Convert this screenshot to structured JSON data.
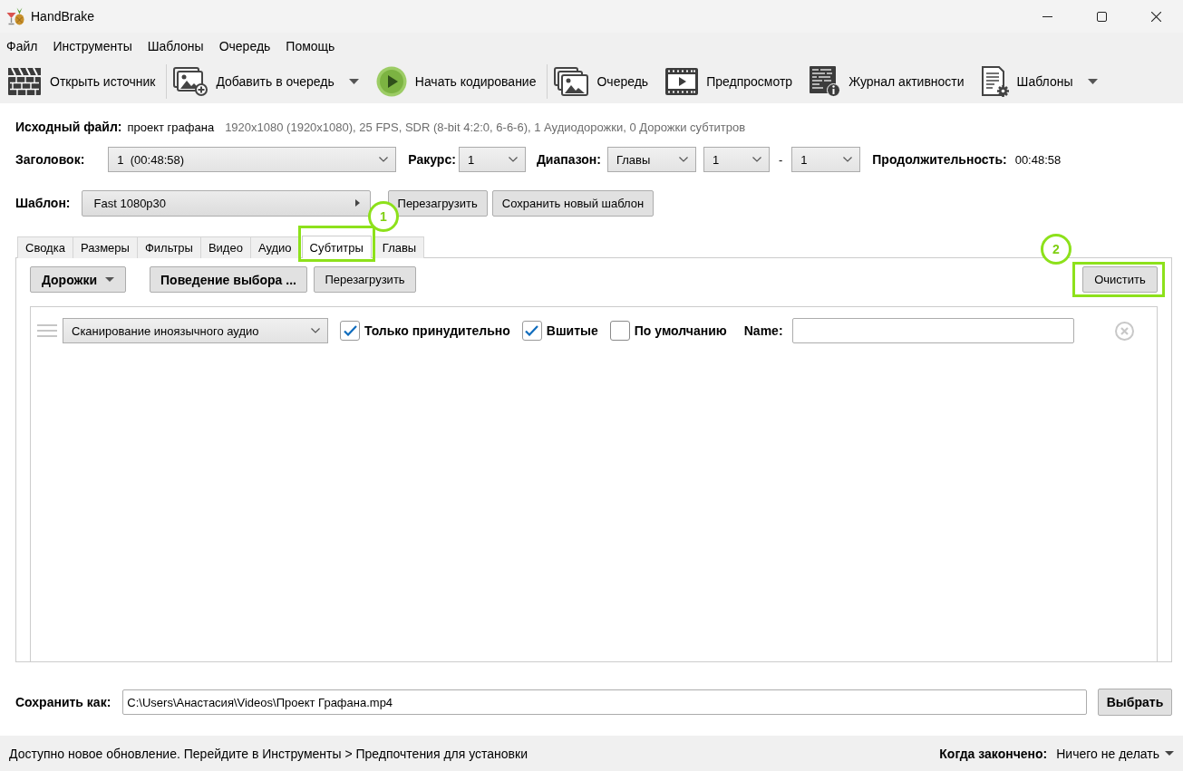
{
  "window": {
    "title": "HandBrake"
  },
  "menu": [
    "Файл",
    "Инструменты",
    "Шаблоны",
    "Очередь",
    "Помощь"
  ],
  "toolbar": [
    {
      "items": [
        {
          "kind": "open",
          "label": "Открыть источник",
          "dropdown": false
        }
      ]
    },
    {
      "items": [
        {
          "kind": "add",
          "label": "Добавить в очередь",
          "dropdown": true
        },
        {
          "kind": "start",
          "label": "Начать кодирование",
          "dropdown": false
        }
      ]
    },
    {
      "items": [
        {
          "kind": "queue",
          "label": "Очередь",
          "dropdown": false
        },
        {
          "kind": "preview",
          "label": "Предпросмотр",
          "dropdown": false
        },
        {
          "kind": "log",
          "label": "Журнал активности",
          "dropdown": false
        },
        {
          "kind": "presets",
          "label": "Шаблоны",
          "dropdown": true
        }
      ]
    }
  ],
  "source": {
    "label": "Исходный файл:",
    "name": "проект графана",
    "details": "1920x1080 (1920x1080), 25 FPS, SDR (8-bit 4:2:0, 6-6-6), 1 Аудиодорожки, 0 Дорожки субтитров"
  },
  "title_row": {
    "title_label": "Заголовок:",
    "title_value": "1  (00:48:58)",
    "angle_label": "Ракурс:",
    "angle_value": "1",
    "range_label": "Диапазон:",
    "range_mode": "Главы",
    "range_start": "1",
    "range_separator": "-",
    "range_end": "1",
    "duration_label": "Продолжительность:",
    "duration_value": "00:48:58"
  },
  "preset": {
    "label": "Шаблон:",
    "value": "Fast 1080p30",
    "buttons": [
      "Перезагрузить",
      "Сохранить новый шаблон"
    ]
  },
  "tabs": [
    {
      "label": "Сводка",
      "selected": false
    },
    {
      "label": "Размеры",
      "selected": false
    },
    {
      "label": "Фильтры",
      "selected": false
    },
    {
      "label": "Видео",
      "selected": false
    },
    {
      "label": "Аудио",
      "selected": false
    },
    {
      "label": "Субтитры",
      "selected": true,
      "callout": "1"
    },
    {
      "label": "Главы",
      "selected": false
    }
  ],
  "subtitles": {
    "buttons": [
      {
        "kind": "menu",
        "label": "Дорожки"
      },
      {
        "kind": "dialog",
        "label": "Поведение выбора ..."
      },
      {
        "kind": "plain",
        "label": "Перезагрузить"
      }
    ],
    "clear_button": {
      "label": "Очистить",
      "callout": "2"
    },
    "tracks": [
      {
        "source": "Сканирование иноязычного аудио",
        "options": [
          {
            "label": "Только принудительно",
            "checked": true
          },
          {
            "label": "Вшитые",
            "checked": true
          },
          {
            "label": "По умолчанию",
            "checked": false
          }
        ],
        "name_label": "Name:"
      }
    ]
  },
  "save_as": {
    "label": "Сохранить как:",
    "path": "C:\\Users\\Анастасия\\Videos\\Проект Графана.mp4",
    "button": "Выбрать"
  },
  "status_bar": {
    "message": "Доступно новое обновление. Перейдите в Инструменты > Предпочтения для установки",
    "when_done_label": "Когда закончено:",
    "when_done_value": "Ничего не делать"
  }
}
